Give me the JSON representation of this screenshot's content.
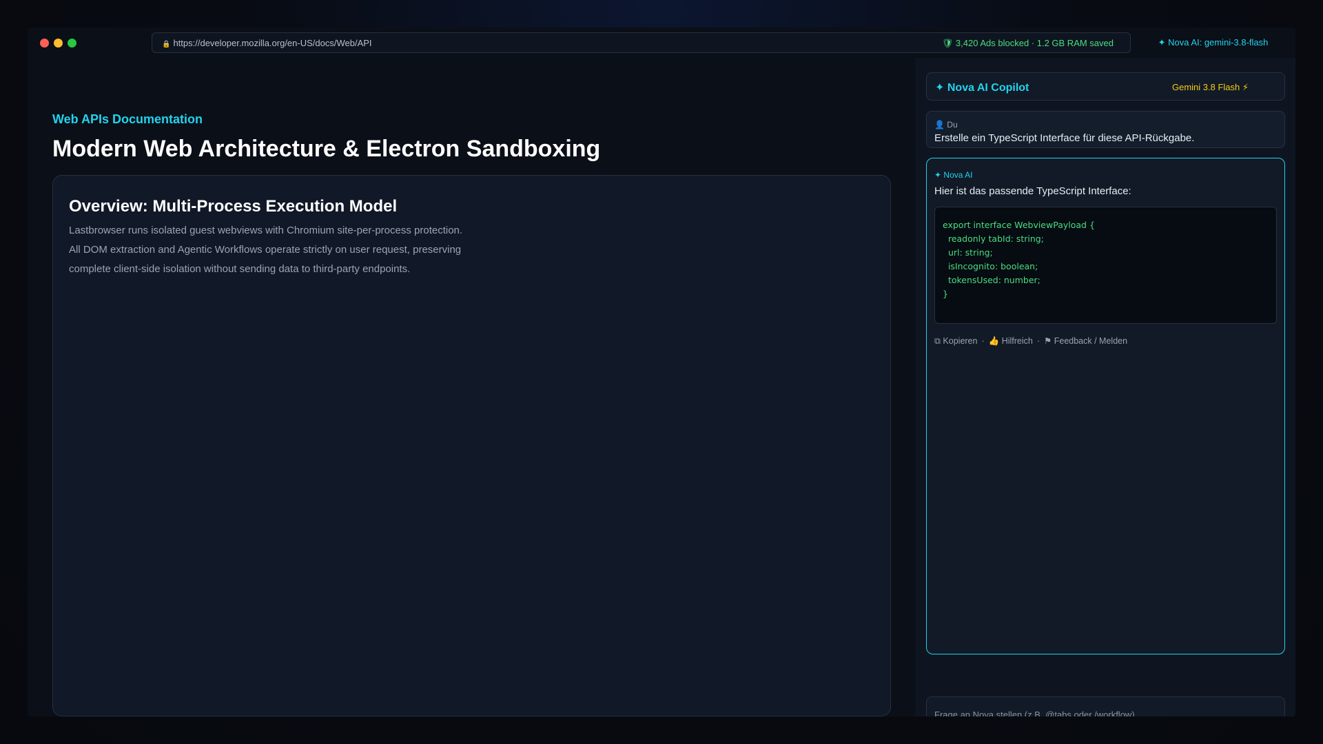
{
  "titlebar": {
    "url_lock_icon": "lock-icon",
    "url": "https://developer.mozilla.org/en-US/docs/Web/API",
    "adblock_icon": "shield-icon",
    "adblock_status": "3,420 Ads blocked · 1.2 GB RAM saved",
    "nova_icon": "sparkle-icon",
    "nova_status": "Nova AI: gemini-3.8-flash",
    "colors": {
      "close": "#ff5f57",
      "minimize": "#febc2e",
      "maximize": "#28c840"
    }
  },
  "main": {
    "section_label": "Web APIs Documentation",
    "title": "Modern Web Architecture & Electron Sandboxing",
    "card": {
      "heading": "Overview: Multi-Process Execution Model",
      "lines": [
        "Lastbrowser runs isolated guest webviews with Chromium site-per-process protection.",
        "All DOM extraction and Agentic Workflows operate strictly on user request, preserving",
        "complete client-side isolation without sending data to third-party endpoints."
      ]
    }
  },
  "sidebar": {
    "header_title": "Nova AI Copilot",
    "header_model": "Gemini 3.8 Flash",
    "user_message": {
      "sender": "Du",
      "text": "Erstelle ein TypeScript Interface für diese API-Rückgabe."
    },
    "ai_message": {
      "sender": "Nova AI",
      "intro": "Hier ist das passende TypeScript Interface:",
      "code": [
        "export interface WebviewPayload {",
        "  readonly tabId: string;",
        "  url: string;",
        "  isIncognito: boolean;",
        "  tokensUsed: number;",
        "}"
      ],
      "actions": {
        "copy": "Kopieren",
        "helpful": "Hilfreich",
        "feedback": "Feedback / Melden"
      }
    },
    "input_placeholder": "Frage an Nova stellen (z.B. @tabs oder /workflow)..."
  },
  "colors": {
    "accent": "#22d3ee",
    "success": "#4ade80",
    "model_badge": "#facc15"
  }
}
